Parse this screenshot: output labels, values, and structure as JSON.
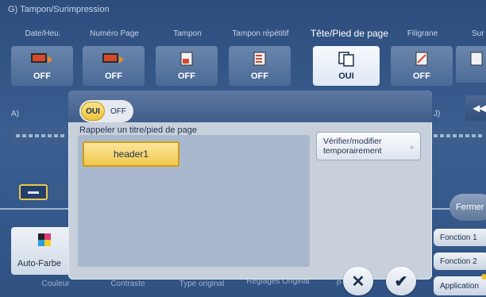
{
  "screen": {
    "section_title": "G) Tampon/Surimpression"
  },
  "tabs": [
    {
      "label": "Date/Heu.",
      "state": "OFF",
      "icon": "date-stamp-icon"
    },
    {
      "label": "Numéro Page",
      "state": "OFF",
      "icon": "page-number-icon"
    },
    {
      "label": "Tampon",
      "state": "OFF",
      "icon": "stamp-icon"
    },
    {
      "label": "Tampon répétitif",
      "state": "OFF",
      "icon": "repeat-stamp-icon"
    },
    {
      "label": "Tête/Pied de page",
      "state": "OUI",
      "icon": "header-footer-icon"
    },
    {
      "label": "Filigrane",
      "state": "OFF",
      "icon": "watermark-icon"
    },
    {
      "label": "Sur",
      "state": "",
      "icon": "overlay-icon"
    }
  ],
  "background": {
    "label_a": "A)",
    "label_j": "J)",
    "back_glyph": "◂◂",
    "fermer": "Fermer",
    "fonction1": "Fonction 1",
    "fonction2": "Fonction 2",
    "application": "Application",
    "auto_farbe": "Auto-Farbe",
    "bottom_labels": [
      "Couleur",
      "Contraste",
      "Type original",
      "Réglages Original",
      "P"
    ]
  },
  "modal": {
    "toggle_on": "OUI",
    "toggle_off": "OFF",
    "recall_label": "Rappeler un titre/pied de page",
    "selected_item": "header1",
    "verify_label": "Vérifier/modifier temporairement",
    "verify_chevron": "»",
    "cancel_glyph": "✕",
    "ok_glyph": "✔"
  },
  "colors": {
    "accent": "#eec43c",
    "background": "#2d4d7d",
    "modal": "#c8d0dc"
  }
}
